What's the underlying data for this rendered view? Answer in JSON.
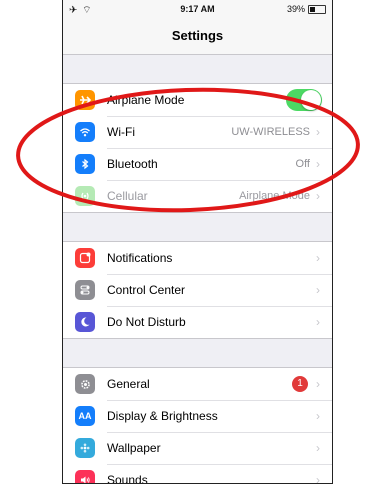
{
  "status": {
    "left": "✈ ⌔",
    "time": "9:17 AM",
    "battery": "39%",
    "battery_level": 0.39
  },
  "nav": {
    "title": "Settings"
  },
  "groups": [
    [
      {
        "label": "Airplane Mode",
        "icon": "airplane-icon",
        "color": "#ff9500",
        "toggle": true
      },
      {
        "label": "Wi-Fi",
        "value": "UW-WIRELESS",
        "icon": "wifi-icon",
        "color": "#147efb"
      },
      {
        "label": "Bluetooth",
        "value": "Off",
        "icon": "bluetooth-icon",
        "color": "#147efb"
      },
      {
        "label": "Cellular",
        "value": "Airplane Mode",
        "icon": "cellular-icon",
        "color": "#b5eab5",
        "disabled": true
      }
    ],
    [
      {
        "label": "Notifications",
        "icon": "notifications-icon",
        "color": "#fc3d39"
      },
      {
        "label": "Control Center",
        "icon": "control-center-icon",
        "color": "#8e8e93"
      },
      {
        "label": "Do Not Disturb",
        "icon": "moon-icon",
        "color": "#5856d6"
      }
    ],
    [
      {
        "label": "General",
        "icon": "gear-icon",
        "color": "#8e8e93",
        "badge": "1"
      },
      {
        "label": "Display & Brightness",
        "icon": "display-icon",
        "color": "#147efb",
        "glyph": "AA"
      },
      {
        "label": "Wallpaper",
        "icon": "wallpaper-icon",
        "color": "#34aadc"
      },
      {
        "label": "Sounds",
        "icon": "speaker-icon",
        "color": "#fc3158"
      }
    ]
  ],
  "annotation_color": "#e01818"
}
